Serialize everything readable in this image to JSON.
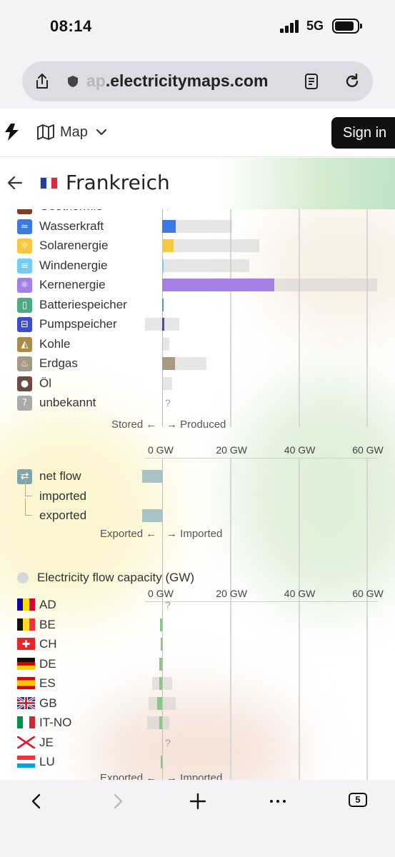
{
  "status_bar": {
    "time": "08:14",
    "network": "5G"
  },
  "browser": {
    "url_faded": "ap",
    "url_main": ".electricitymaps.com",
    "tab_count": "5"
  },
  "header": {
    "nav_label": "Map",
    "signin_label": "Sign in"
  },
  "country": {
    "name": "Frankreich"
  },
  "production": {
    "rows": [
      {
        "label": "Geothermie",
        "icon": "geothermal-icon",
        "color": "#8b3a1e",
        "unknown": true
      },
      {
        "label": "Wasserkraft",
        "icon": "hydro-icon",
        "color": "#3b7be0",
        "value_gw": 3.9,
        "capacity_gw": 20.6
      },
      {
        "label": "Solarenergie",
        "icon": "solar-icon",
        "color": "#f4c842",
        "value_gw": 3.4,
        "capacity_gw": 28.5
      },
      {
        "label": "Windenergie",
        "icon": "wind-icon",
        "color": "#74cdf0",
        "value_gw": 0.5,
        "capacity_gw": 25.5
      },
      {
        "label": "Kernenergie",
        "icon": "nuclear-icon",
        "color": "#a57ee6",
        "value_gw": 33.0,
        "capacity_gw": 63.0
      },
      {
        "label": "Batteriespeicher",
        "icon": "battery-storage-icon",
        "color": "#4aaa82",
        "value_gw": 0.1,
        "capacity_gw": 0.5
      },
      {
        "label": "Pumpspeicher",
        "icon": "pumped-storage-icon",
        "color": "#3d4dc8",
        "value_gw": 0.6,
        "capacity_gw": 5.0,
        "storage_capacity_gw": 5.0
      },
      {
        "label": "Kohle",
        "icon": "coal-icon",
        "color": "#a98c4a",
        "value_gw": 0,
        "capacity_gw": 2.0
      },
      {
        "label": "Erdgas",
        "icon": "gas-icon",
        "color": "#a79a84",
        "value_gw": 3.7,
        "capacity_gw": 13.0
      },
      {
        "label": "Öl",
        "icon": "oil-icon",
        "color": "#6b4b42",
        "value_gw": 0,
        "capacity_gw": 3.0
      },
      {
        "label": "unbekannt",
        "icon": "unknown-icon",
        "color": "#aaaaaa",
        "unknown": true
      }
    ],
    "left_label": "Stored ←",
    "right_label": "→ Produced"
  },
  "axis": {
    "ticks": [
      "0 GW",
      "20 GW",
      "40 GW",
      "60 GW"
    ],
    "max_gw": 63
  },
  "net_flow": {
    "label": "net flow",
    "exported_value_gw": -5.8,
    "rows": [
      {
        "label": "imported",
        "value_gw": 0
      },
      {
        "label": "exported",
        "value_gw": -5.8
      }
    ],
    "left_label": "Exported ←",
    "right_label": "→ Imported"
  },
  "flow_capacity": {
    "title": "Electricity flow capacity (GW)",
    "rows": [
      {
        "label": "AD",
        "flag": "andorra-flag-icon",
        "unknown": true
      },
      {
        "label": "BE",
        "flag": "belgium-flag-icon",
        "value_gw": 0.6,
        "export_cap_gw": 0,
        "import_cap_gw": 0
      },
      {
        "label": "CH",
        "flag": "switzerland-flag-icon",
        "value_gw": 0.5,
        "export_cap_gw": 0,
        "import_cap_gw": 0
      },
      {
        "label": "DE",
        "flag": "germany-flag-icon",
        "value_gw": 0.8,
        "export_cap_gw": 0,
        "import_cap_gw": 0
      },
      {
        "label": "ES",
        "flag": "spain-flag-icon",
        "value_gw": 0.9,
        "export_cap_gw": 3.0,
        "import_cap_gw": 3.0
      },
      {
        "label": "GB",
        "flag": "uk-flag-icon",
        "value_gw": 1.5,
        "export_cap_gw": 4.0,
        "import_cap_gw": 4.0
      },
      {
        "label": "IT-NO",
        "flag": "italy-flag-icon",
        "value_gw": 0.9,
        "export_cap_gw": 4.5,
        "import_cap_gw": 2.0
      },
      {
        "label": "JE",
        "flag": "jersey-flag-icon",
        "unknown": true
      },
      {
        "label": "LU",
        "flag": "luxembourg-flag-icon",
        "value_gw": 0.2,
        "export_cap_gw": 0,
        "import_cap_gw": 0
      }
    ],
    "left_label": "Exported ←",
    "right_label": "→ Imported"
  }
}
